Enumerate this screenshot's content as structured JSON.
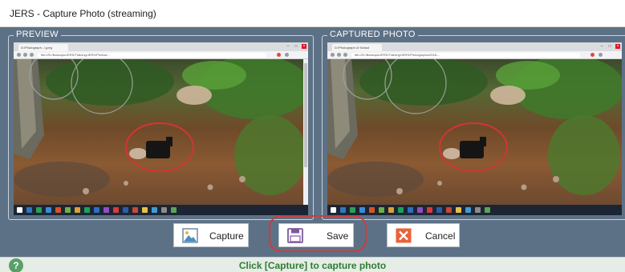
{
  "window": {
    "title": "JERS - Capture Photo (streaming)"
  },
  "preview": {
    "label": "PREVIEW",
    "browser_tab": "D:\\Photograph...\\.jpeg",
    "url": "file:///D:/Backups/JERS/Training/JERS/Photos/..."
  },
  "captured": {
    "label": "CAPTURED PHOTO",
    "browser_tab": "D:\\Photograph of Scissd",
    "url": "file:///D:/Backups/JERS/Training/JERS/Photographs/2018-..."
  },
  "buttons": {
    "capture": {
      "label": "Capture",
      "icon": "image-icon"
    },
    "save": {
      "label": "Save",
      "icon": "floppy-disk-icon"
    },
    "cancel": {
      "label": "Cancel",
      "icon": "close-icon"
    }
  },
  "status": {
    "text": "Click [Capture] to capture photo",
    "icon": "help-icon",
    "color": "#2e7d32"
  },
  "colors": {
    "panel_background": "#5d7186",
    "highlight_ring": "#d23a3a",
    "status_background": "#e6ece6"
  }
}
